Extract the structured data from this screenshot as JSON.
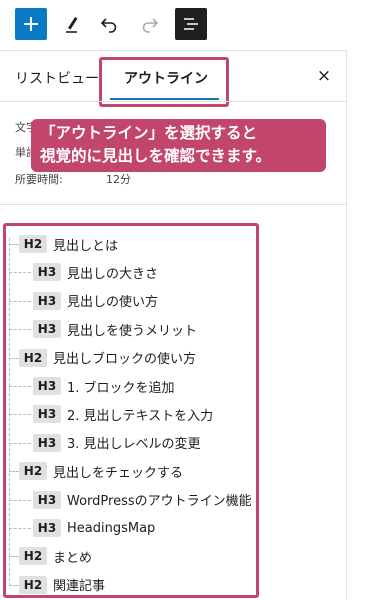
{
  "toolbar": {
    "add_icon": "plus-icon",
    "tools_icon": "pen-icon",
    "undo_icon": "undo-icon",
    "redo_icon": "redo-icon",
    "outline_icon": "document-overview-icon",
    "accent": "#0a7ac5"
  },
  "tabs": {
    "list_view": "リストビュー",
    "outline": "アウトライン",
    "close_symbol": "×"
  },
  "stats": {
    "characters_label": "文字",
    "words_label": "単語",
    "time_label": "所要時間:",
    "time_value": "12分"
  },
  "callout": {
    "line1": "「アウトライン」を選択すると",
    "line2": "視覚的に見出しを確認できます。",
    "color": "#c2466c"
  },
  "outline": [
    {
      "level": "H2",
      "text": "見出しとは"
    },
    {
      "level": "H3",
      "text": "見出しの大きさ"
    },
    {
      "level": "H3",
      "text": "見出しの使い方"
    },
    {
      "level": "H3",
      "text": "見出しを使うメリット"
    },
    {
      "level": "H2",
      "text": "見出しブロックの使い方"
    },
    {
      "level": "H3",
      "text": "1. ブロックを追加"
    },
    {
      "level": "H3",
      "text": "2. 見出しテキストを入力"
    },
    {
      "level": "H3",
      "text": "3. 見出しレベルの変更"
    },
    {
      "level": "H2",
      "text": "見出しをチェックする"
    },
    {
      "level": "H3",
      "text": "WordPressのアウトライン機能"
    },
    {
      "level": "H3",
      "text": "HeadingsMap"
    },
    {
      "level": "H2",
      "text": "まとめ"
    },
    {
      "level": "H2",
      "text": "関連記事"
    }
  ]
}
